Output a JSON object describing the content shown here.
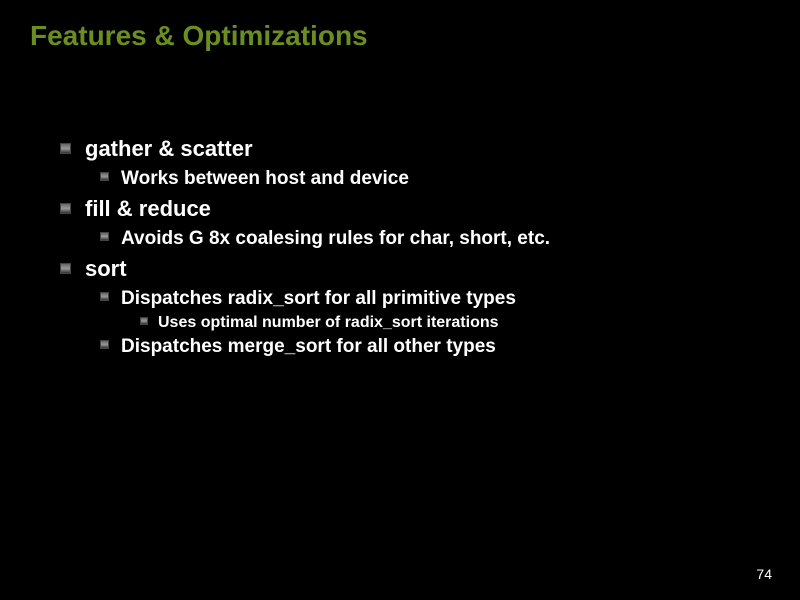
{
  "title": "Features & Optimizations",
  "items": [
    {
      "label": "gather & scatter",
      "children": [
        {
          "label": "Works between host and device"
        }
      ]
    },
    {
      "label": "fill & reduce",
      "children": [
        {
          "label": "Avoids G 8x coalesing rules for char, short, etc."
        }
      ]
    },
    {
      "label": "sort",
      "children": [
        {
          "label": "Dispatches radix_sort  for all primitive types",
          "children": [
            {
              "label": "Uses optimal number of radix_sort iterations"
            }
          ]
        },
        {
          "label": "Dispatches merge_sort  for all other types"
        }
      ]
    }
  ],
  "page_number": "74"
}
